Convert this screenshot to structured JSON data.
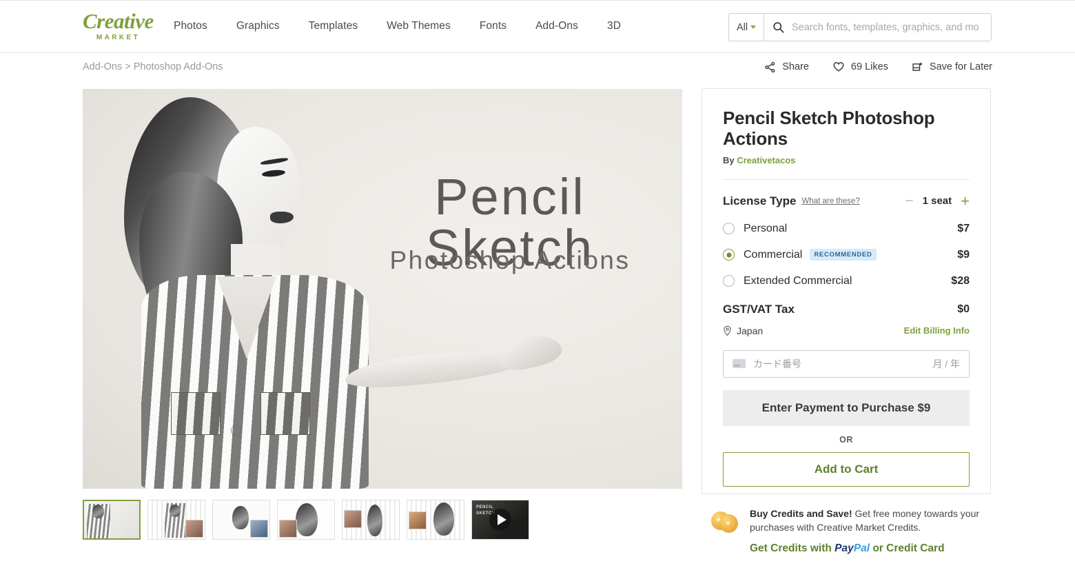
{
  "header": {
    "logo_word": "Creative",
    "logo_sub": "MARKET",
    "nav": [
      {
        "label": "Photos"
      },
      {
        "label": "Graphics"
      },
      {
        "label": "Templates"
      },
      {
        "label": "Web Themes"
      },
      {
        "label": "Fonts"
      },
      {
        "label": "Add-Ons"
      },
      {
        "label": "3D"
      }
    ],
    "search": {
      "scope": "All",
      "placeholder": "Search fonts, templates, graphics, and mo",
      "value": ""
    }
  },
  "breadcrumb": {
    "full": "Add-Ons > Photoshop Add-Ons",
    "parent": "Add-Ons",
    "separator": ">",
    "current": "Photoshop Add-Ons"
  },
  "actions": {
    "share": "Share",
    "likes": "69 Likes",
    "save": "Save for Later"
  },
  "hero": {
    "title": "Pencil Sketch",
    "subtitle": "Photoshop Actions"
  },
  "thumbnails": [
    {
      "label": "thumbnail-1-cover",
      "selected": true
    },
    {
      "label": "thumbnail-2",
      "selected": false
    },
    {
      "label": "thumbnail-3",
      "selected": false
    },
    {
      "label": "thumbnail-4",
      "selected": false
    },
    {
      "label": "thumbnail-5",
      "selected": false
    },
    {
      "label": "thumbnail-6",
      "selected": false
    },
    {
      "label": "thumbnail-7-video",
      "selected": false,
      "video": true,
      "video_caption": "PENCIL\nSKETCH"
    }
  ],
  "product": {
    "title": "Pencil Sketch Photoshop Actions",
    "by_prefix": "By",
    "author": "Creativetacos",
    "license_label": "License Type",
    "license_help": "What are these?",
    "stepper": {
      "minus": "−",
      "value": "1 seat",
      "plus": "+"
    },
    "licenses": [
      {
        "name": "Personal",
        "price": "$7",
        "selected": false,
        "badge": ""
      },
      {
        "name": "Commercial",
        "price": "$9",
        "selected": true,
        "badge": "RECOMMENDED"
      },
      {
        "name": "Extended Commercial",
        "price": "$28",
        "selected": false,
        "badge": ""
      }
    ],
    "tax_label": "GST/VAT Tax",
    "tax_value": "$0",
    "country": "Japan",
    "edit_billing": "Edit Billing Info",
    "card_placeholder": "カード番号",
    "card_expiry_placeholder": "月 / 年",
    "pay_button": "Enter Payment to Purchase $9",
    "or": "OR",
    "cart_button": "Add to Cart"
  },
  "credits": {
    "headline": "Buy Credits and Save!",
    "body": "Get free money towards your purchases with Creative Market Credits.",
    "link_prefix": "Get Credits with",
    "paypal_a": "Pay",
    "paypal_b": "Pal",
    "link_suffix": "or Credit Card"
  },
  "colors": {
    "brand_green": "#7fa03c",
    "dark_green": "#5f7f2c",
    "badge_bg": "#d6eaf8",
    "badge_text": "#2a6496",
    "text_dark": "#2b2b2b",
    "muted": "#9a9a9a"
  }
}
